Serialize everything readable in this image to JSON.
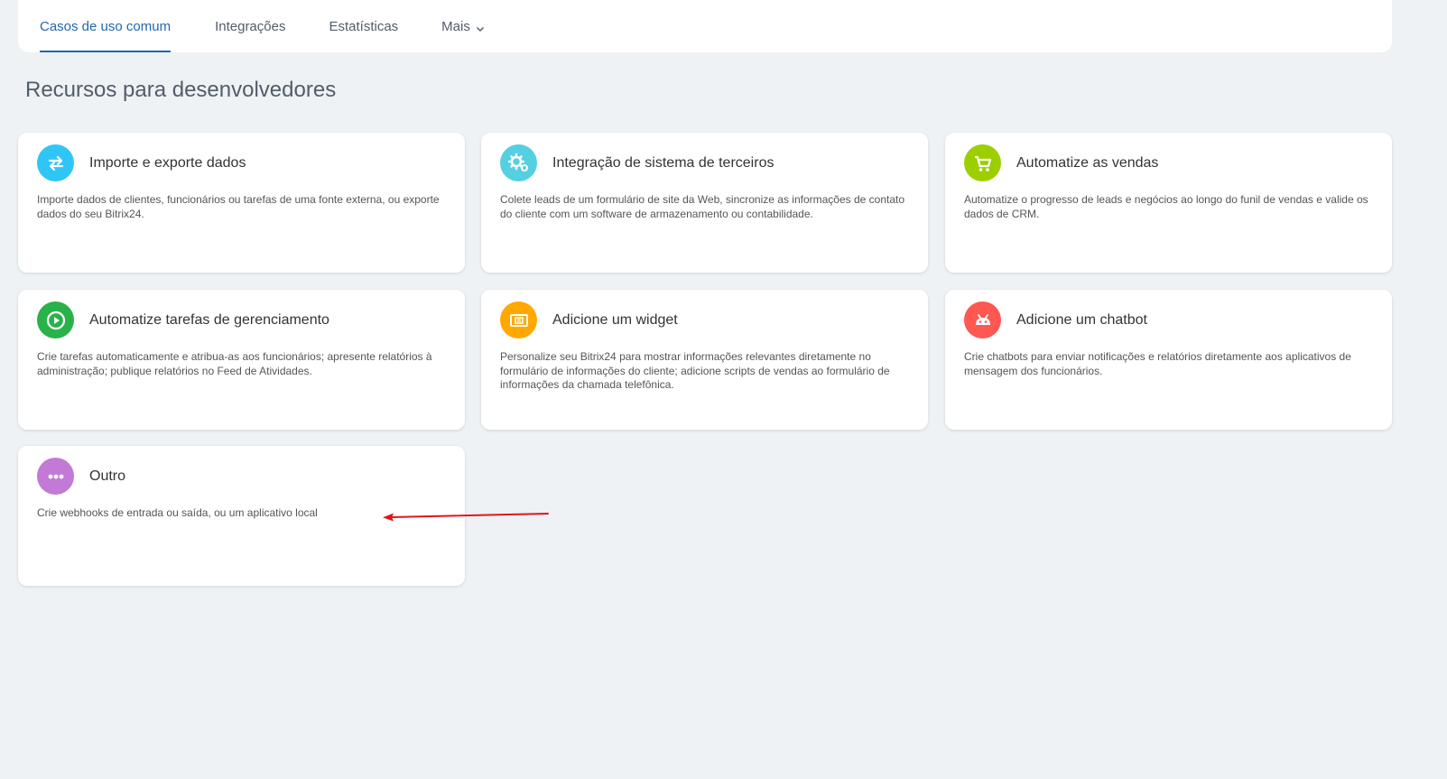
{
  "tabs": [
    {
      "label": "Casos de uso comum",
      "active": true
    },
    {
      "label": "Integrações",
      "active": false
    },
    {
      "label": "Estatísticas",
      "active": false
    },
    {
      "label": "Mais",
      "active": false,
      "has_dropdown": true
    }
  ],
  "page_title": "Recursos para desenvolvedores",
  "cards": [
    {
      "title": "Importe e exporte dados",
      "description": "Importe dados de clientes, funcionários ou tarefas de uma fonte externa, ou exporte dados do seu Bitrix24.",
      "icon": "import-export-icon",
      "color": "#2fc6f6"
    },
    {
      "title": "Integração de sistema de terceiros",
      "description": "Colete leads de um formulário de site da Web, sincronize as informações de contato do cliente com um software de armazenamento ou contabilidade.",
      "icon": "gears-icon",
      "color": "#55d0e0"
    },
    {
      "title": "Automatize as vendas",
      "description": "Automatize o progresso de leads e negócios ao longo do funil de vendas e valide os dados de CRM.",
      "icon": "cart-icon",
      "color": "#9dcf00"
    },
    {
      "title": "Automatize tarefas de gerenciamento",
      "description": "Crie tarefas automaticamente e atribua-as aos funcionários; apresente relatórios à administração; publique relatórios no Feed de Atividades.",
      "icon": "play-icon",
      "color": "#2ab24a"
    },
    {
      "title": "Adicione um widget",
      "description": "Personalize seu Bitrix24 para mostrar informações relevantes diretamente no formulário de informações do cliente; adicione scripts de vendas ao formulário de informações da chamada telefônica.",
      "icon": "widget-icon",
      "color": "#ffa900"
    },
    {
      "title": "Adicione um chatbot",
      "description": "Crie chatbots para enviar notificações e relatórios diretamente aos aplicativos de mensagem dos funcionários.",
      "icon": "robot-icon",
      "color": "#ff5752"
    },
    {
      "title": "Outro",
      "description": "Crie webhooks de entrada ou saída, ou um aplicativo local",
      "icon": "more-dots-icon",
      "color": "#c27ad6"
    }
  ],
  "annotation_arrow_color": "#e0161b"
}
